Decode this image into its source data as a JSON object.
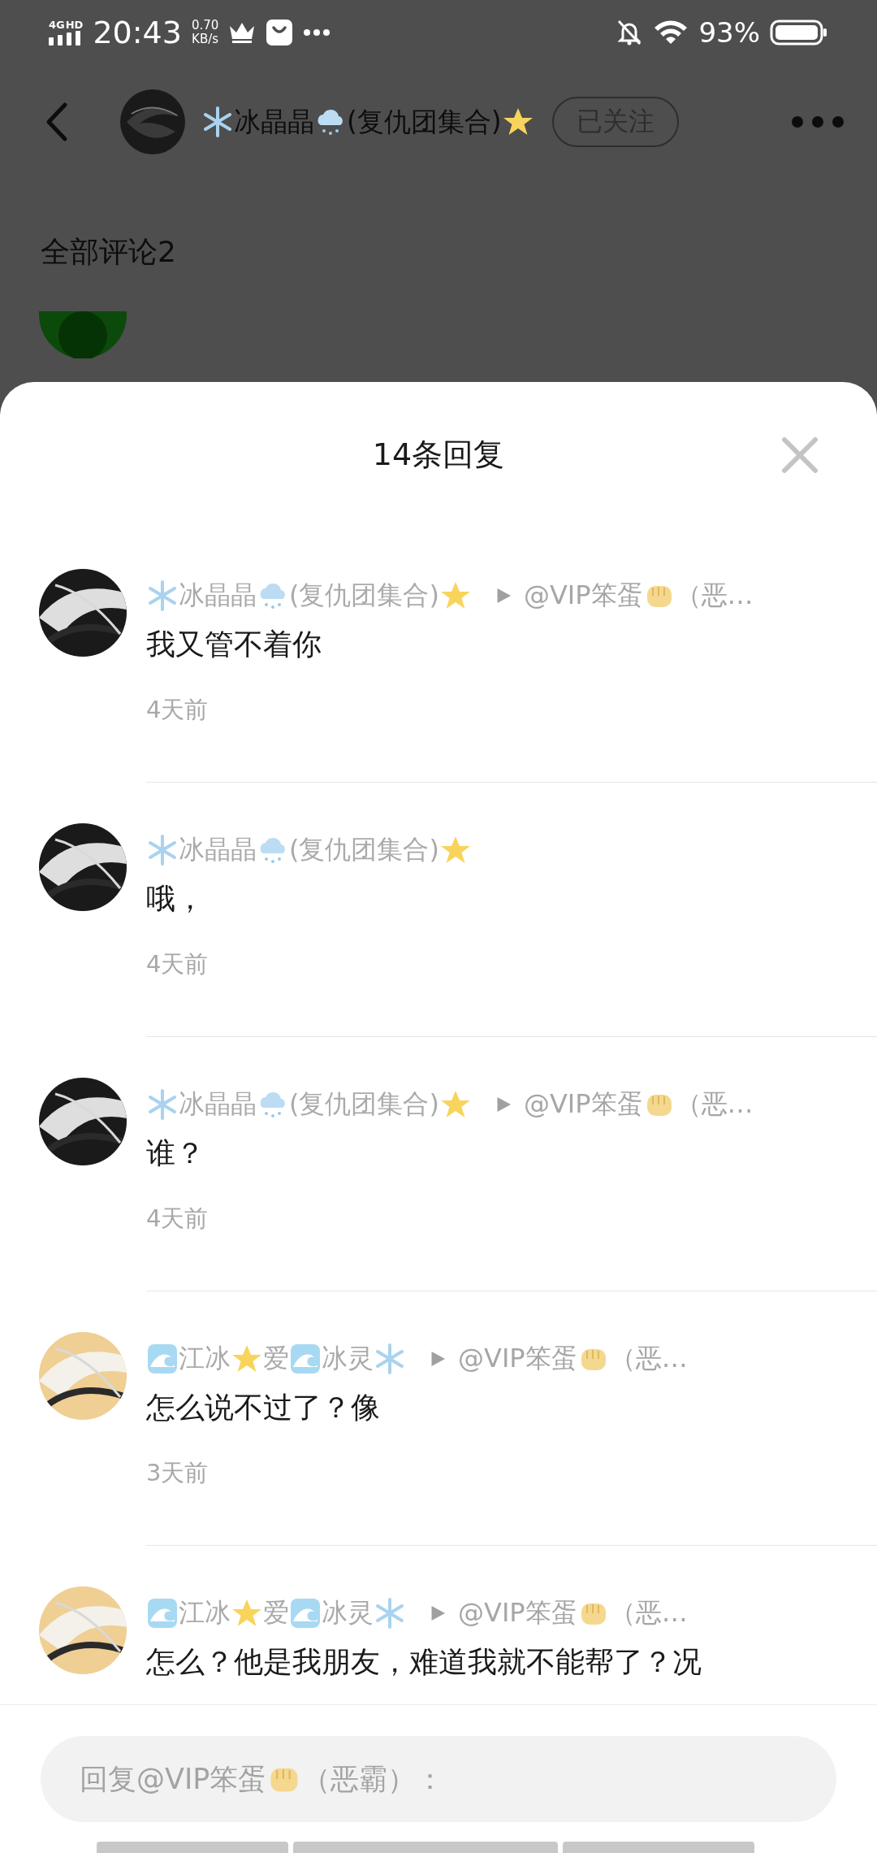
{
  "status_bar": {
    "network": "4G",
    "network_badge": "HD",
    "time": "20:43",
    "speed": "0.70",
    "speed_unit": "KB/s",
    "battery": "93%"
  },
  "header": {
    "name_parts": [
      {
        "kind": "snowflake"
      },
      {
        "kind": "text",
        "text": "冰晶晶"
      },
      {
        "kind": "snow-cloud"
      },
      {
        "kind": "text",
        "text": "(复仇团集合)"
      },
      {
        "kind": "star"
      }
    ],
    "follow_button": "已关注",
    "avatar": {
      "color": "#1a1a1a"
    }
  },
  "section_title": "全部评论2",
  "behind_comment": {
    "avatar": {
      "color": "#0b4a0b"
    }
  },
  "sheet": {
    "title": "14条回复"
  },
  "replies": [
    {
      "avatar": {
        "color": "#1a1a1a"
      },
      "author": [
        {
          "kind": "snowflake"
        },
        {
          "kind": "text",
          "text": "冰晶晶"
        },
        {
          "kind": "snow-cloud"
        },
        {
          "kind": "text",
          "text": "(复仇团集合)"
        },
        {
          "kind": "star"
        }
      ],
      "reply_to": [
        {
          "kind": "text",
          "text": "@VIP笨蛋"
        },
        {
          "kind": "fist"
        },
        {
          "kind": "text",
          "text": "（恶…"
        }
      ],
      "text": "我又管不着你",
      "time": "4天前"
    },
    {
      "avatar": {
        "color": "#1a1a1a"
      },
      "author": [
        {
          "kind": "snowflake"
        },
        {
          "kind": "text",
          "text": "冰晶晶"
        },
        {
          "kind": "snow-cloud"
        },
        {
          "kind": "text",
          "text": "(复仇团集合)"
        },
        {
          "kind": "star"
        }
      ],
      "text": "哦，",
      "time": "4天前"
    },
    {
      "avatar": {
        "color": "#1a1a1a"
      },
      "author": [
        {
          "kind": "snowflake"
        },
        {
          "kind": "text",
          "text": "冰晶晶"
        },
        {
          "kind": "snow-cloud"
        },
        {
          "kind": "text",
          "text": "(复仇团集合)"
        },
        {
          "kind": "star"
        }
      ],
      "reply_to": [
        {
          "kind": "text",
          "text": "@VIP笨蛋"
        },
        {
          "kind": "fist"
        },
        {
          "kind": "text",
          "text": "（恶…"
        }
      ],
      "text": "谁？",
      "time": "4天前"
    },
    {
      "avatar": {
        "color": "#efcf93"
      },
      "author": [
        {
          "kind": "wave"
        },
        {
          "kind": "text",
          "text": "江冰"
        },
        {
          "kind": "star"
        },
        {
          "kind": "text",
          "text": "爱"
        },
        {
          "kind": "wave"
        },
        {
          "kind": "text",
          "text": "冰灵"
        },
        {
          "kind": "snowflake"
        }
      ],
      "reply_to": [
        {
          "kind": "text",
          "text": "@VIP笨蛋"
        },
        {
          "kind": "fist"
        },
        {
          "kind": "text",
          "text": "（恶…"
        }
      ],
      "text": "怎么说不过了？像",
      "time": "3天前"
    },
    {
      "avatar": {
        "color": "#efcf93"
      },
      "author": [
        {
          "kind": "wave"
        },
        {
          "kind": "text",
          "text": "江冰"
        },
        {
          "kind": "star"
        },
        {
          "kind": "text",
          "text": "爱"
        },
        {
          "kind": "wave"
        },
        {
          "kind": "text",
          "text": "冰灵"
        },
        {
          "kind": "snowflake"
        }
      ],
      "reply_to": [
        {
          "kind": "text",
          "text": "@VIP笨蛋"
        },
        {
          "kind": "fist"
        },
        {
          "kind": "text",
          "text": "（恶…"
        }
      ],
      "text": "怎么？他是我朋友，难道我就不能帮了？况"
    }
  ],
  "reply_box": {
    "placeholder": [
      {
        "kind": "text",
        "text": "回复@VIP笨蛋"
      },
      {
        "kind": "fist"
      },
      {
        "kind": "text",
        "text": "（恶霸）："
      }
    ]
  }
}
